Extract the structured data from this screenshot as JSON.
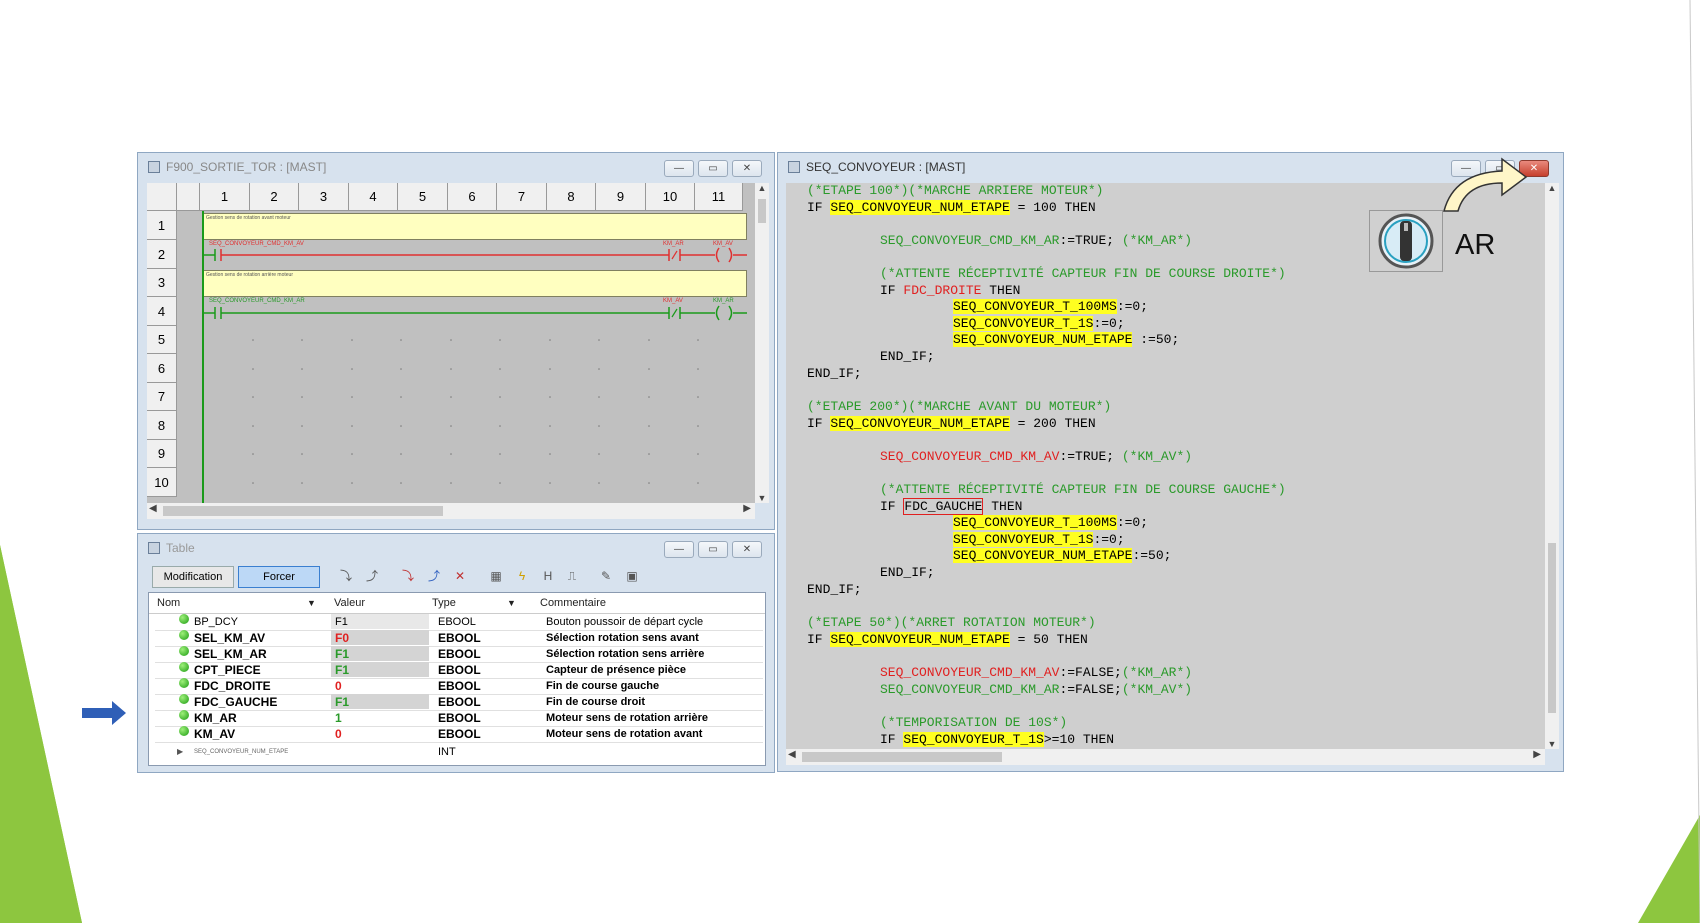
{
  "ladder_window": {
    "title": "F900_SORTIE_TOR : [MAST]",
    "columns": [
      "1",
      "2",
      "3",
      "4",
      "5",
      "6",
      "7",
      "8",
      "9",
      "10",
      "11"
    ],
    "rows": [
      "1",
      "2",
      "3",
      "4",
      "5",
      "6",
      "7",
      "8",
      "9",
      "10"
    ],
    "rung1_comment": "Gestion sens de rotation avant moteur",
    "rung2_contact": "SEQ_CONVOYEUR_CMD_KM_AV",
    "rung2_nc_contact": "KM_AR",
    "rung2_coil": "KM_AV",
    "rung3_comment": "Gestion sens de rotation arrière moteur",
    "rung4_contact": "SEQ_CONVOYEUR_CMD_KM_AR",
    "rung4_nc_contact": "KM_AV",
    "rung4_coil": "KM_AR"
  },
  "table_window": {
    "title": "Table",
    "modification_label": "Modification",
    "forcer_label": "Forcer",
    "headers": {
      "name": "Nom",
      "value": "Valeur",
      "type": "Type",
      "comment": "Commentaire"
    },
    "rows": [
      {
        "name": "BP_DCY",
        "value": "F1",
        "type": "EBOOL",
        "comment": "Bouton poussoir de départ cycle"
      },
      {
        "name": "SEL_KM_AV",
        "value": "F0",
        "type": "EBOOL",
        "comment": "Sélection rotation sens avant"
      },
      {
        "name": "SEL_KM_AR",
        "value": "F1",
        "type": "EBOOL",
        "comment": "Sélection rotation sens arrière"
      },
      {
        "name": "CPT_PIECE",
        "value": "F1",
        "type": "EBOOL",
        "comment": "Capteur de présence pièce"
      },
      {
        "name": "FDC_DROITE",
        "value": "0",
        "type": "EBOOL",
        "comment": "Fin de course gauche"
      },
      {
        "name": "FDC_GAUCHE",
        "value": "F1",
        "type": "EBOOL",
        "comment": "Fin de course droit"
      },
      {
        "name": "KM_AR",
        "value": "1",
        "type": "EBOOL",
        "comment": "Moteur sens de rotation arrière"
      },
      {
        "name": "KM_AV",
        "value": "0",
        "type": "EBOOL",
        "comment": "Moteur sens de rotation avant"
      }
    ],
    "last_row": {
      "name": "SEQ_CONVOYEUR_NUM_ETAPE",
      "type": "INT"
    }
  },
  "code_window": {
    "title": "SEQ_CONVOYEUR : [MAST]",
    "ar_label": "AR",
    "lines": {
      "l1": "(*ETAPE 100*)(*MARCHE ARRIERE MOTEUR*)",
      "l2_if": "IF ",
      "l2_var": "SEQ_CONVOYEUR_NUM_ETAPE",
      "l2_rest": " = 100 THEN",
      "l3_var": "SEQ_CONVOYEUR_CMD_KM_AR",
      "l3_rest": ":=TRUE; ",
      "l3_cm": "(*KM_AR*)",
      "l4": "(*ATTENTE RÉCEPTIVITÉ CAPTEUR FIN DE COURSE DROITE*)",
      "l5_if": "IF ",
      "l5_var": "FDC_DROITE",
      "l5_rest": " THEN",
      "l6_var": "SEQ_CONVOYEUR_T_100MS",
      "l6_rest": ":=0;",
      "l7_var": "SEQ_CONVOYEUR_T_1S",
      "l7_rest": ":=0;",
      "l8_var": "SEQ_CONVOYEUR_NUM_ETAPE",
      "l8_rest": " :=50;",
      "l9": "END_IF;",
      "l10": "END_IF;",
      "l11": "(*ETAPE 200*)(*MARCHE AVANT DU MOTEUR*)",
      "l12_var": "SEQ_CONVOYEUR_NUM_ETAPE",
      "l12_rest": " = 200 THEN",
      "l13_var": "SEQ_CONVOYEUR_CMD_KM_AV",
      "l13_rest": ":=TRUE; ",
      "l13_cm": "(*KM_AV*)",
      "l14": "(*ATTENTE RÉCEPTIVITÉ CAPTEUR FIN DE COURSE GAUCHE*)",
      "l15_var": "FDC_GAUCHE",
      "l15_rest": " THEN",
      "l16_var": "SEQ_CONVOYEUR_T_100MS",
      "l16_rest": ":=0;",
      "l17_var": "SEQ_CONVOYEUR_T_1S",
      "l17_rest": ":=0;",
      "l18_var": "SEQ_CONVOYEUR_NUM_ETAPE",
      "l18_rest": ":=50;",
      "l19": "END_IF;",
      "l20": "END_IF;",
      "l21": "(*ETAPE 50*)(*ARRET ROTATION MOTEUR*)",
      "l22_var": "SEQ_CONVOYEUR_NUM_ETAPE",
      "l22_rest": " = 50 THEN",
      "l23_var": "SEQ_CONVOYEUR_CMD_KM_AV",
      "l23_rest": ":=FALSE;",
      "l23_cm": "(*KM_AR*)",
      "l24_var": "SEQ_CONVOYEUR_CMD_KM_AR",
      "l24_rest": ":=FALSE;",
      "l24_cm": "(*KM_AV*)",
      "l25": "(*TEMPORISATION DE 10S*)",
      "l26_if": "IF ",
      "l26_var": "SEQ_CONVOYEUR_T_1S",
      "l26_rest": ">=10 THEN"
    }
  },
  "colors": {
    "accent_green": "#8dc63f",
    "arrow_blue": "#2f5fb7",
    "highlight": "#ffff20"
  }
}
